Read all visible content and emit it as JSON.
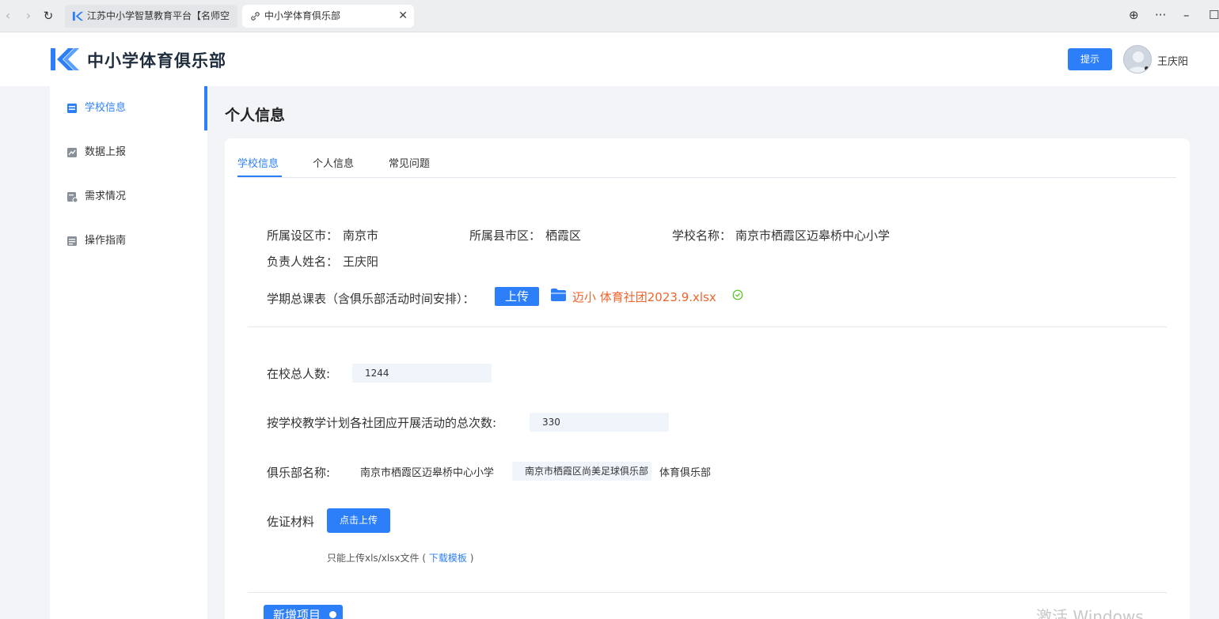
{
  "browser": {
    "tabs": [
      {
        "title": "江苏中小学智慧教育平台【名师空"
      },
      {
        "title": "中小学体育俱乐部",
        "close": "✕"
      }
    ],
    "controls": {
      "back": "‹",
      "forward": "›",
      "reload": "↻",
      "globe": "⊕",
      "more": "···",
      "minimize": "–",
      "restore": "☐"
    }
  },
  "header": {
    "site_title": "中小学体育俱乐部",
    "hint_button": "提示",
    "user_name": "王庆阳"
  },
  "sidebar": {
    "items": [
      {
        "label": "学校信息",
        "icon": "school-info-icon",
        "active": true
      },
      {
        "label": "数据上报",
        "icon": "chart-icon"
      },
      {
        "label": "需求情况",
        "icon": "requirement-icon"
      },
      {
        "label": "操作指南",
        "icon": "guide-icon"
      }
    ]
  },
  "main": {
    "page_title": "个人信息",
    "tabs": [
      {
        "label": "学校信息",
        "active": true
      },
      {
        "label": "个人信息"
      },
      {
        "label": "常见问题"
      }
    ],
    "info": {
      "city_label": "所属设区市：",
      "city": "南京市",
      "district_label": "所属县市区：",
      "district": "栖霞区",
      "school_label": "学校名称：",
      "school": "南京市栖霞区迈皋桥中心小学",
      "principal_label": "负责人姓名：",
      "principal": "王庆阳",
      "schedule_label": "学期总课表（含俱乐部活动时间安排）：",
      "upload_label": "上传",
      "file_name": "迈小 体育社团2023.9.xlsx"
    },
    "form": {
      "students_label": "在校总人数:",
      "students": "1244",
      "activities_label": "按学校教学计划各社团应开展活动的总次数:",
      "activities": "330",
      "club_label": "俱乐部名称:",
      "club_prefix": "南京市栖霞区迈皋桥中心小学",
      "club_name": "南京市栖霞区尚美足球俱乐部",
      "club_suffix": "体育俱乐部",
      "evidence_label": "佐证材料",
      "click_upload": "点击上传",
      "hint": "只能上传xls/xlsx文件 (",
      "hint_link": "下载模板",
      "hint_end": ")",
      "add_project": "新增项目"
    }
  },
  "watermark": "激活 Windows",
  "colors": {
    "accent": "#2d7ff9",
    "file": "#f0642d",
    "success": "#52c41a"
  }
}
